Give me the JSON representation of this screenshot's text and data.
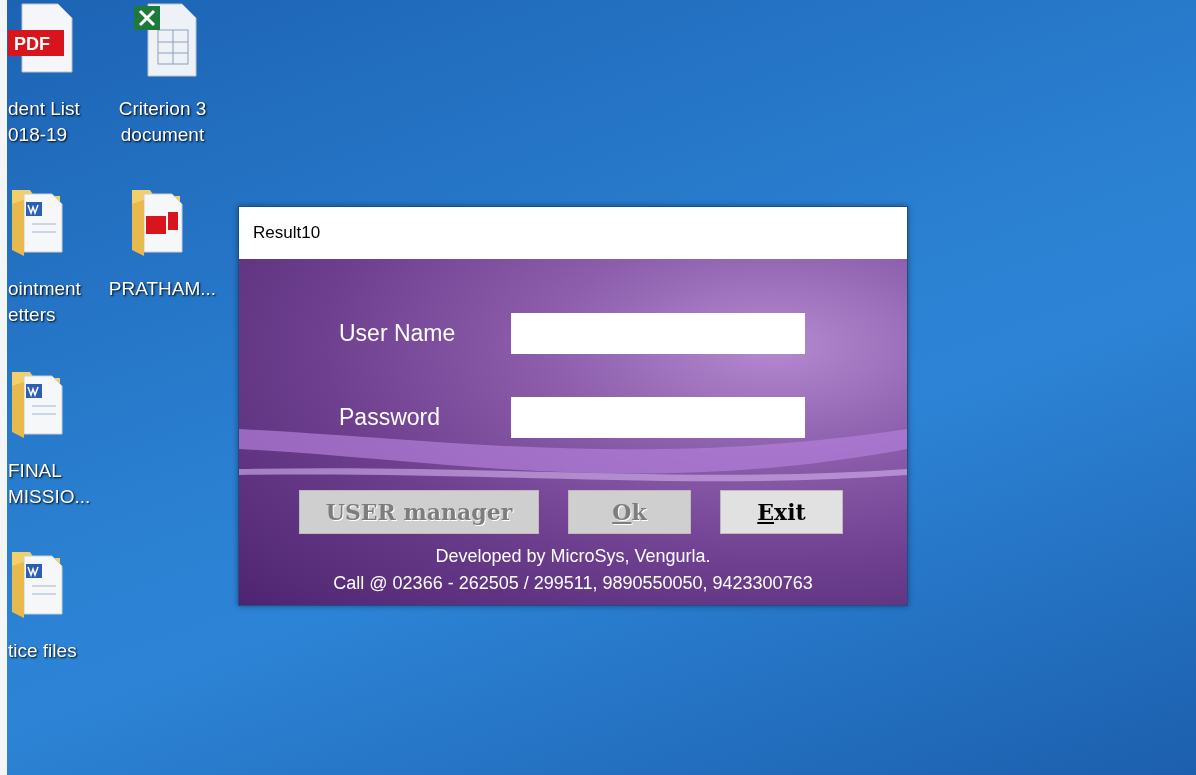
{
  "desktop_icons": [
    {
      "kind": "pdf",
      "badge": "PDF",
      "label_lines": [
        "dent List",
        "018-19"
      ]
    },
    {
      "kind": "excel",
      "label_lines": [
        "Criterion 3",
        "document"
      ]
    },
    {
      "kind": "word-folder",
      "label_lines": [
        "ointment",
        "etters"
      ]
    },
    {
      "kind": "pdf-folder",
      "label_lines": [
        "PRATHAM..."
      ]
    },
    {
      "kind": "word-folder",
      "label_lines": [
        "FINAL",
        "MISSIO..."
      ]
    },
    {
      "kind": "word-folder",
      "label_lines": [
        "tice files"
      ]
    }
  ],
  "window": {
    "title": "Result10",
    "fields": [
      {
        "label": "User Name"
      },
      {
        "label": "Password"
      }
    ],
    "buttons": [
      {
        "label": "USER manager",
        "disabled": true,
        "mnemonic_underlined": false
      },
      {
        "label": "Ok",
        "disabled": true,
        "mnemonic_underlined": true
      },
      {
        "label": "Exit",
        "disabled": false,
        "mnemonic_underlined": true
      }
    ],
    "footer_lines": [
      "Developed by MicroSys, Vengurla.",
      "Call @ 02366 - 262505 / 299511, 9890550050, 9423300763"
    ]
  }
}
